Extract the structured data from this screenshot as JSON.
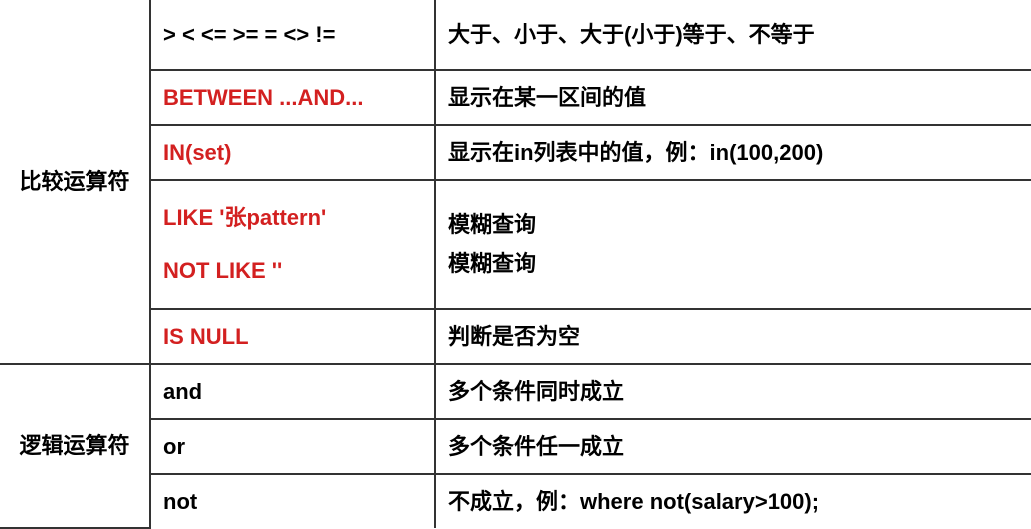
{
  "categories": {
    "comparison": "比较运算符",
    "logical": "逻辑运算符"
  },
  "rows": {
    "r1": {
      "operator": ">   <   <=   >=   =  <> !=",
      "description": "大于、小于、大于(小于)等于、不等于"
    },
    "r2": {
      "operator": "BETWEEN  ...AND...",
      "description": "显示在某一区间的值"
    },
    "r3": {
      "operator": "IN(set)",
      "description": "显示在in列表中的值，例：in(100,200)"
    },
    "r4": {
      "operator_line1": "LIKE   '张pattern'",
      "operator_line2": "NOT LIKE   ''",
      "description_line1": "模糊查询",
      "description_line2": "模糊查询"
    },
    "r5": {
      "operator": "IS NULL",
      "description": "判断是否为空"
    },
    "r6": {
      "operator": "and",
      "description": "多个条件同时成立"
    },
    "r7": {
      "operator": "or",
      "description": "多个条件任一成立"
    },
    "r8": {
      "operator": "not",
      "description": "不成立，例：where not(salary>100);"
    }
  }
}
